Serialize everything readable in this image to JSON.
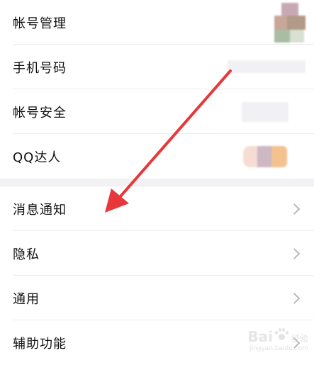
{
  "account_section": {
    "items": [
      {
        "label": "帐号管理"
      },
      {
        "label": "手机号码"
      },
      {
        "label": "帐号安全"
      },
      {
        "label": "QQ达人"
      }
    ]
  },
  "settings_section": {
    "items": [
      {
        "label": "消息通知"
      },
      {
        "label": "隐私"
      },
      {
        "label": "通用"
      },
      {
        "label": "辅助功能"
      }
    ]
  },
  "watermark": {
    "brand": "Bai",
    "suffix": "经验",
    "url": "jingyan.baidu.com"
  },
  "annotation": {
    "arrow_color": "#e8373b"
  }
}
